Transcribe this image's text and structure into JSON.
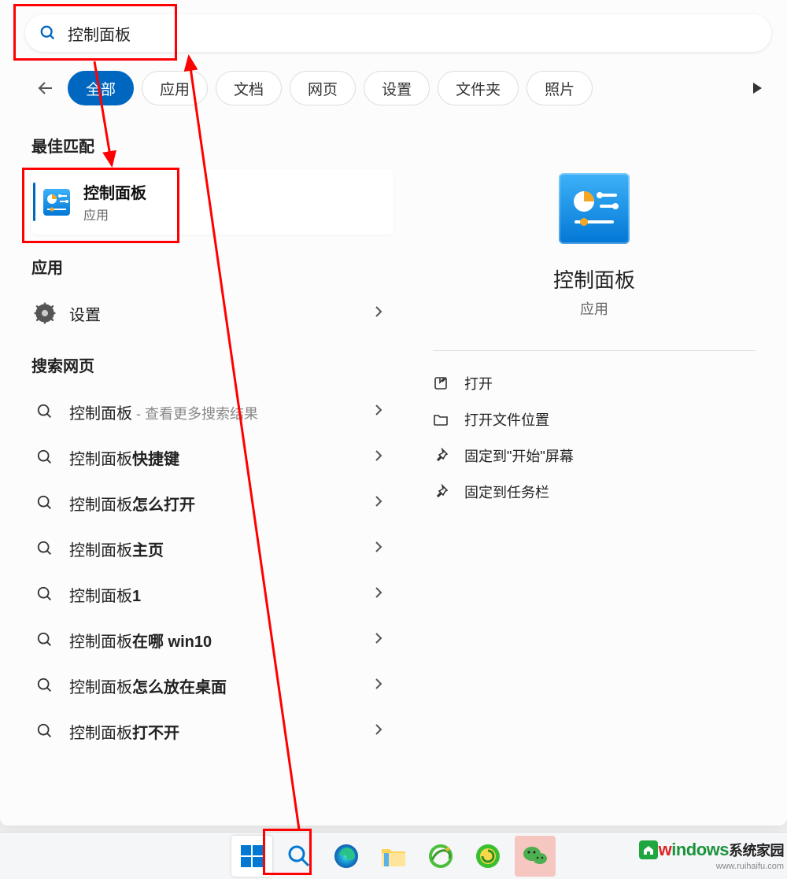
{
  "search": {
    "query": "控制面板"
  },
  "filters": [
    {
      "label": "全部",
      "active": true
    },
    {
      "label": "应用",
      "active": false
    },
    {
      "label": "文档",
      "active": false
    },
    {
      "label": "网页",
      "active": false
    },
    {
      "label": "设置",
      "active": false
    },
    {
      "label": "文件夹",
      "active": false
    },
    {
      "label": "照片",
      "active": false
    }
  ],
  "sections": {
    "best": "最佳匹配",
    "apps": "应用",
    "web": "搜索网页"
  },
  "bestMatch": {
    "title": "控制面板",
    "subtitle": "应用"
  },
  "appItems": [
    {
      "label": "设置"
    }
  ],
  "webItems": [
    {
      "prefix": "控制面板",
      "bold": "",
      "suffix": " - 查看更多搜索结果"
    },
    {
      "prefix": "控制面板",
      "bold": "快捷键",
      "suffix": ""
    },
    {
      "prefix": "控制面板",
      "bold": "怎么打开",
      "suffix": ""
    },
    {
      "prefix": "控制面板",
      "bold": "主页",
      "suffix": ""
    },
    {
      "prefix": "控制面板",
      "bold": "1",
      "suffix": ""
    },
    {
      "prefix": "控制面板",
      "bold": "在哪 win10",
      "suffix": ""
    },
    {
      "prefix": "控制面板",
      "bold": "怎么放在桌面",
      "suffix": ""
    },
    {
      "prefix": "控制面板",
      "bold": "打不开",
      "suffix": ""
    }
  ],
  "detail": {
    "title": "控制面板",
    "subtitle": "应用"
  },
  "actions": [
    {
      "icon": "open",
      "label": "打开"
    },
    {
      "icon": "folder",
      "label": "打开文件位置"
    },
    {
      "icon": "pin",
      "label": "固定到\"开始\"屏幕"
    },
    {
      "icon": "pin",
      "label": "固定到任务栏"
    }
  ],
  "watermark": {
    "brand_pre": "w",
    "brand_rest": "indows",
    "brand_cn": "系统家园",
    "url": "www.ruihaifu.com"
  }
}
